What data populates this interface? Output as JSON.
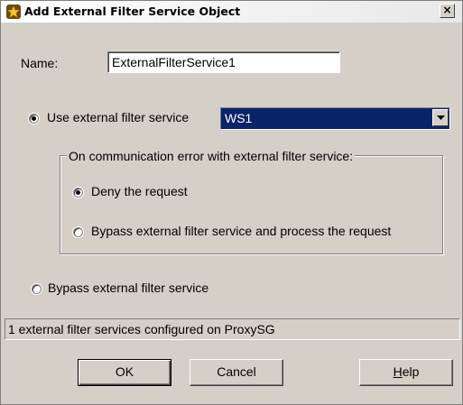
{
  "window": {
    "title": "Add External Filter Service Object",
    "close_label": "×",
    "icon": "proxy-star-icon"
  },
  "name_label": "Name:",
  "name_value": "ExternalFilterService1",
  "use_service": {
    "label": "Use external filter service",
    "selected": true,
    "combo_value": "WS1"
  },
  "error_group": {
    "legend": "On communication error with external filter service:",
    "options": [
      {
        "label": "Deny the request",
        "selected": true
      },
      {
        "label": "Bypass external filter service and process the request",
        "selected": false
      }
    ]
  },
  "bypass_service": {
    "label": "Bypass external filter service",
    "selected": false
  },
  "status_text": "1 external filter services configured on ProxySG",
  "buttons": {
    "ok": "OK",
    "cancel": "Cancel",
    "help_mnemonic": "H",
    "help_rest": "elp"
  },
  "colors": {
    "dialog_bg": "#d4d0c8",
    "selection": "#0a246a"
  }
}
